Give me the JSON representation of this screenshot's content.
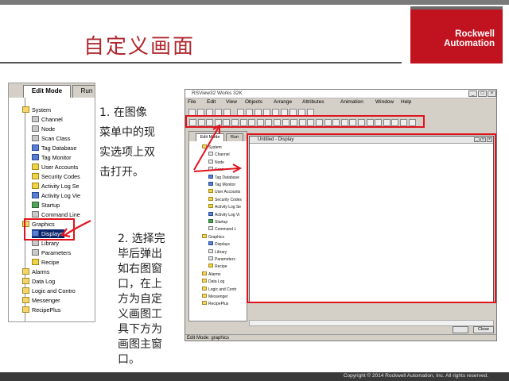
{
  "slide": {
    "title": "自定义画面",
    "logo": {
      "line1": "Rockwell",
      "line2": "Automation"
    },
    "copyright": "Copyright © 2014 Rockwell Automation, Inc. All rights reserved."
  },
  "left_screenshot": {
    "tabs": [
      "Edit Mode",
      "Run"
    ],
    "tree": [
      {
        "label": "System",
        "icon": "folder-icon",
        "level": 0
      },
      {
        "label": "Channel",
        "icon": "channel-icon",
        "level": 1
      },
      {
        "label": "Node",
        "icon": "node-icon",
        "level": 1
      },
      {
        "label": "Scan Class",
        "icon": "scan-class-icon",
        "level": 1
      },
      {
        "label": "Tag Database",
        "icon": "tag-database-icon",
        "level": 1
      },
      {
        "label": "Tag Monitor",
        "icon": "tag-monitor-icon",
        "level": 1
      },
      {
        "label": "User Accounts",
        "icon": "user-accounts-icon",
        "level": 1
      },
      {
        "label": "Security Codes",
        "icon": "security-codes-icon",
        "level": 1
      },
      {
        "label": "Activity Log Se",
        "icon": "activity-log-icon",
        "level": 1
      },
      {
        "label": "Activity Log Vie",
        "icon": "activity-log-view-icon",
        "level": 1
      },
      {
        "label": "Startup",
        "icon": "startup-icon",
        "level": 1
      },
      {
        "label": "Command Line",
        "icon": "command-line-icon",
        "level": 1
      },
      {
        "label": "Graphics",
        "icon": "folder-icon",
        "level": 0
      },
      {
        "label": "Displays",
        "icon": "displays-icon",
        "level": 1,
        "selected": true
      },
      {
        "label": "Library",
        "icon": "library-icon",
        "level": 1
      },
      {
        "label": "Parameters",
        "icon": "parameters-icon",
        "level": 1
      },
      {
        "label": "Recipe",
        "icon": "recipe-icon",
        "level": 1
      },
      {
        "label": "Alarms",
        "icon": "folder-icon",
        "level": 0
      },
      {
        "label": "Data Log",
        "icon": "folder-icon",
        "level": 0
      },
      {
        "label": "Logic and Contro",
        "icon": "folder-icon",
        "level": 0
      },
      {
        "label": "Messenger",
        "icon": "folder-icon",
        "level": 0
      },
      {
        "label": "RecipePlus",
        "icon": "folder-icon",
        "level": 0
      }
    ]
  },
  "instructions": {
    "step1": "1. 在图像菜单中的现实选项上双击打开。",
    "step2": "2. 选择完毕后弹出如右图窗口，在上方为自定义画图工具下方为画图主窗口。"
  },
  "right_screenshot": {
    "title": "RSView32 Works 32K",
    "window_buttons": [
      "_",
      "□",
      "×"
    ],
    "menu": [
      "File",
      "Edit",
      "View",
      "Objects",
      "Arrange",
      "Attributes",
      "Animation",
      "Window",
      "Help"
    ],
    "tabs": [
      "Edit Mode",
      "Run"
    ],
    "tree": [
      "System",
      "Channel",
      "Node",
      "Scan",
      "Tag Database",
      "Tag Monitor",
      "User Accounts",
      "Security Codes",
      "Activity Log Se",
      "Activity Log Vi",
      "Startup",
      "Command L",
      "Graphics",
      "Displays",
      "Library",
      "Parameters",
      "Recipe",
      "Alarms",
      "Data Log",
      "Logic and Contr",
      "Messenger",
      "RecipePlus"
    ],
    "display_title": "Untitled - Display",
    "bottom_buttons": [
      "Close"
    ],
    "status": "Edit Mode: graphics"
  },
  "colors": {
    "accent": "#b0282e",
    "highlight": "#e0141e",
    "logo_bg": "#c1121f"
  }
}
